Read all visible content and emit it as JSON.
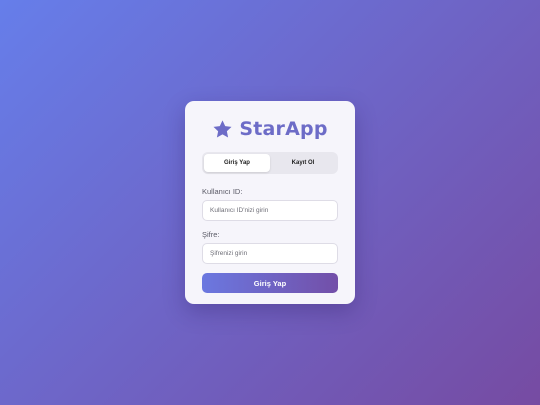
{
  "app": {
    "name": "StarApp",
    "logo_icon": "star-icon",
    "brand_color": "#6d6cc7"
  },
  "tabs": [
    {
      "label": "Giriş Yap",
      "active": true
    },
    {
      "label": "Kayıt Ol",
      "active": false
    }
  ],
  "form": {
    "user_id": {
      "label": "Kullanıcı ID:",
      "placeholder": "Kullanıcı ID'nizi girin",
      "value": ""
    },
    "password": {
      "label": "Şifre:",
      "placeholder": "Şifrenizi girin",
      "value": ""
    },
    "submit_label": "Giriş Yap"
  },
  "colors": {
    "background_start": "#667eea",
    "background_end": "#764ba2",
    "button_start": "#6b78e0",
    "button_end": "#734fa8"
  }
}
